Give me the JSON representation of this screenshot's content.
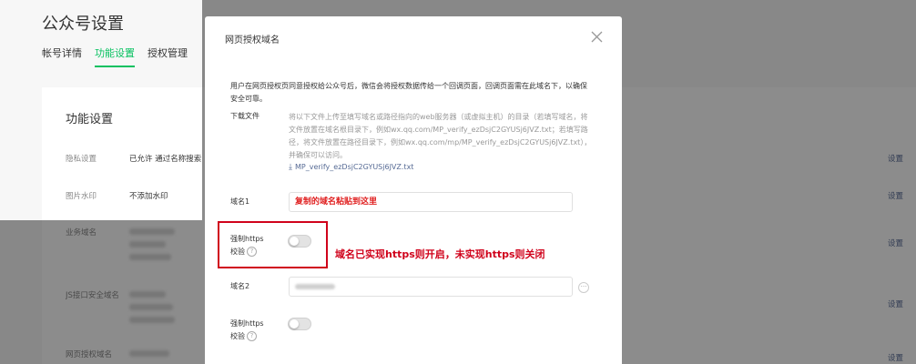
{
  "page": {
    "title": "公众号设置",
    "tabs": [
      {
        "label": "帐号详情",
        "active": false
      },
      {
        "label": "功能设置",
        "active": true
      },
      {
        "label": "授权管理",
        "active": false
      }
    ]
  },
  "panel": {
    "title": "功能设置",
    "set_label": "设置",
    "rows": [
      {
        "label": "隐私设置",
        "value": "已允许 通过名称搜索"
      },
      {
        "label": "图片水印",
        "value": "不添加水印"
      },
      {
        "label": "业务域名",
        "value": ""
      },
      {
        "label": "JS接口安全域名",
        "value": ""
      },
      {
        "label": "网页授权域名",
        "value": ""
      }
    ]
  },
  "dialog": {
    "title": "网页授权域名",
    "close_icon": "close-icon",
    "description": "用户在网页授权页同意授权给公众号后，微信会将授权数据传给一个回调页面，回调页面需在此域名下，以确保安全可靠。",
    "download": {
      "label": "下载文件",
      "text": "将以下文件上传至填写域名或路径指向的web服务器（或虚拟主机）的目录（若填写域名，将文件放置在域名根目录下，例如wx.qq.com/MP_verify_ezDsjC2GYUSj6JVZ.txt；若填写路径，将文件放置在路径目录下，例如wx.qq.com/mp/MP_verify_ezDsjC2GYUSj6JVZ.txt），并确保可以访问。",
      "file_link": "MP_verify_ezDsjC2GYUSj6JVZ.txt",
      "icon": "download-icon"
    },
    "domain1": {
      "label": "域名1",
      "value": "复制的域名粘贴到这里"
    },
    "https1": {
      "label_line1": "强制https",
      "label_line2": "校验",
      "help": "?",
      "on": false
    },
    "annotation": "域名已实现https则开启，未实现https则关闭",
    "domain2": {
      "label": "域名2",
      "more": "···"
    },
    "https2": {
      "label_line1": "强制https",
      "label_line2": "校验",
      "help": "?",
      "on": false
    }
  },
  "colors": {
    "accent": "#07c160",
    "link": "#576b95",
    "annotation": "#d0021b"
  }
}
